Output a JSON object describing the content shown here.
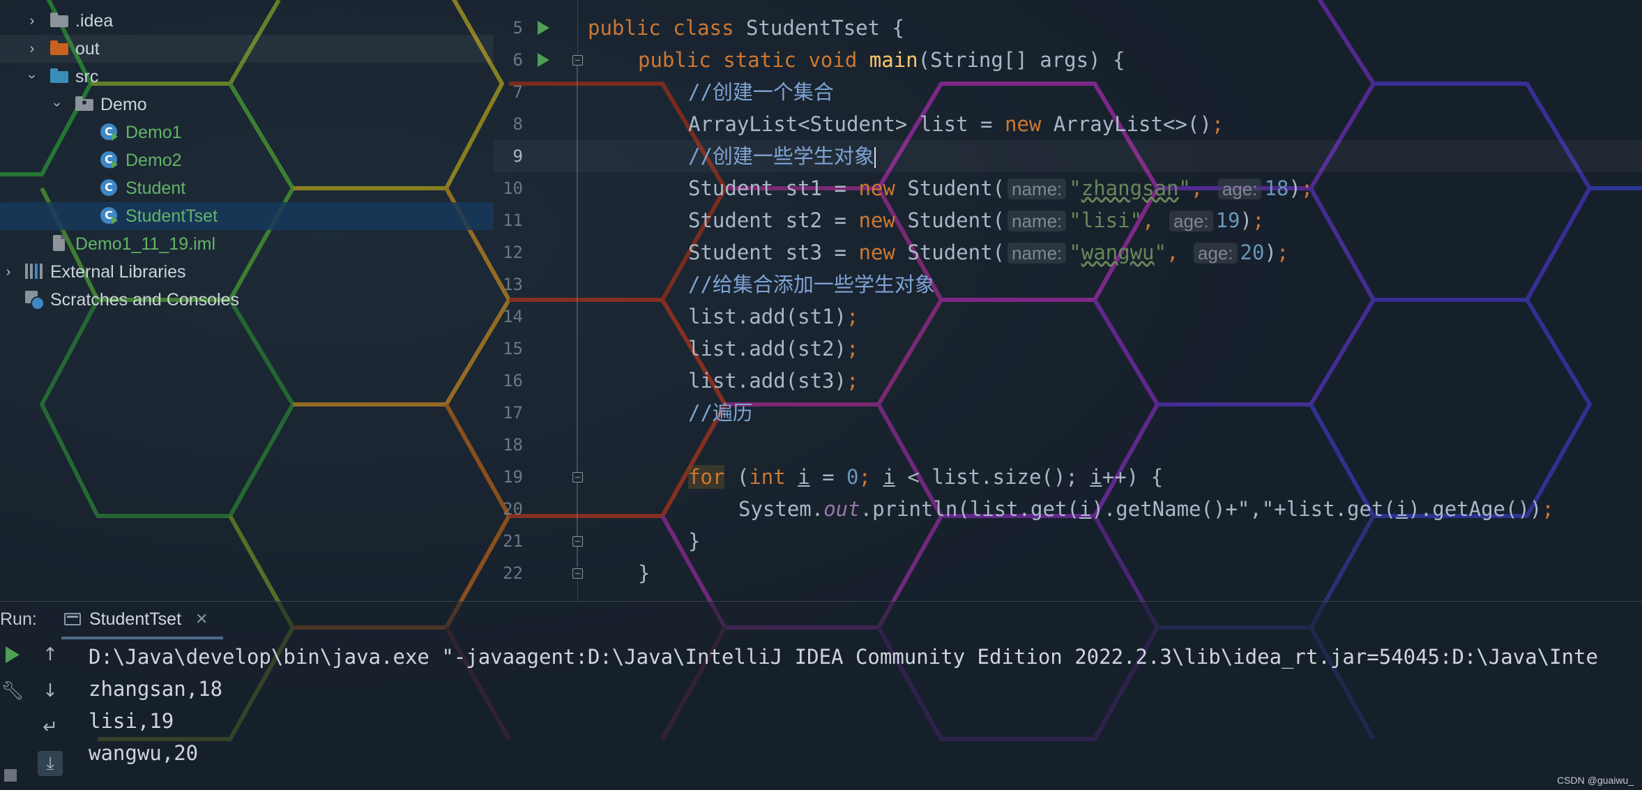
{
  "project_tree": {
    "items": [
      {
        "label": ".idea",
        "icon": "folder-icon"
      },
      {
        "label": "out",
        "icon": "folder-icon"
      },
      {
        "label": "src",
        "icon": "source-folder-icon"
      },
      {
        "label": "Demo",
        "icon": "package-icon"
      },
      {
        "label": "Demo1",
        "icon": "java-class-icon"
      },
      {
        "label": "Demo2",
        "icon": "java-class-icon"
      },
      {
        "label": "Student",
        "icon": "java-class-icon"
      },
      {
        "label": "StudentTset",
        "icon": "java-class-icon"
      },
      {
        "label": "Demo1_11_19.iml",
        "icon": "iml-file-icon"
      },
      {
        "label": "External Libraries",
        "icon": "libraries-icon"
      },
      {
        "label": "Scratches and Consoles",
        "icon": "scratches-icon"
      }
    ]
  },
  "editor": {
    "line_numbers": [
      "5",
      "6",
      "7",
      "8",
      "9",
      "10",
      "11",
      "12",
      "13",
      "14",
      "15",
      "16",
      "17",
      "18",
      "19",
      "20",
      "21",
      "22"
    ],
    "current_line": "9",
    "code": {
      "l5_kw1": "public",
      "l5_kw2": "class",
      "l5_name": "StudentTset",
      "l5_tail": " {",
      "l6_kw1": "public",
      "l6_kw2": "static",
      "l6_kw3": "void",
      "l6_fn": "main",
      "l6_tail": "(String[] args) {",
      "l7_comment": "//创建一个集合",
      "l8_a": "ArrayList<Student> list = ",
      "l8_kw": "new",
      "l8_b": " ArrayList<>()",
      "l9_comment": "//创建一些学生对象",
      "students": [
        {
          "var": "st1",
          "name": "zhangsan",
          "age": "18"
        },
        {
          "var": "st2",
          "name": "lisi",
          "age": "19"
        },
        {
          "var": "st3",
          "name": "wangwu",
          "age": "20"
        }
      ],
      "student_prefix": "Student ",
      "new_kw": "new",
      "student_call": " Student(",
      "hint_name": "name:",
      "hint_age": "age:",
      "l13_comment": "//给集合添加一些学生对象",
      "add_lines": [
        "list.add(st1)",
        "list.add(st2)",
        "list.add(st3)"
      ],
      "l17_comment": "//遍历",
      "l19_for": "for",
      "l19_int": "int",
      "l19_rest": " < list.size(); ",
      "l20_sys": "System.",
      "l20_out": "out",
      "l20_rest": ".println(list.get(",
      "l20_mid": ").getName()+\",\"+list.get(",
      "l20_end": ").getAge())",
      "l21": "}",
      "l22": "}"
    }
  },
  "run_panel": {
    "label": "Run:",
    "tab_label": "StudentTset",
    "console_lines": [
      "D:\\Java\\develop\\bin\\java.exe \"-javaagent:D:\\Java\\IntelliJ IDEA Community Edition 2022.2.3\\lib\\idea_rt.jar=54045:D:\\Java\\Inte",
      "zhangsan,18",
      "lisi,19",
      "wangwu,20"
    ]
  },
  "watermark": "CSDN @guaiwu_",
  "colors": {
    "keyword": "#cc7832",
    "comment": "#7ea3d4",
    "string": "#6a8759",
    "number": "#6897bb",
    "method": "#ffc66d",
    "class_name_green": "#64b468"
  }
}
